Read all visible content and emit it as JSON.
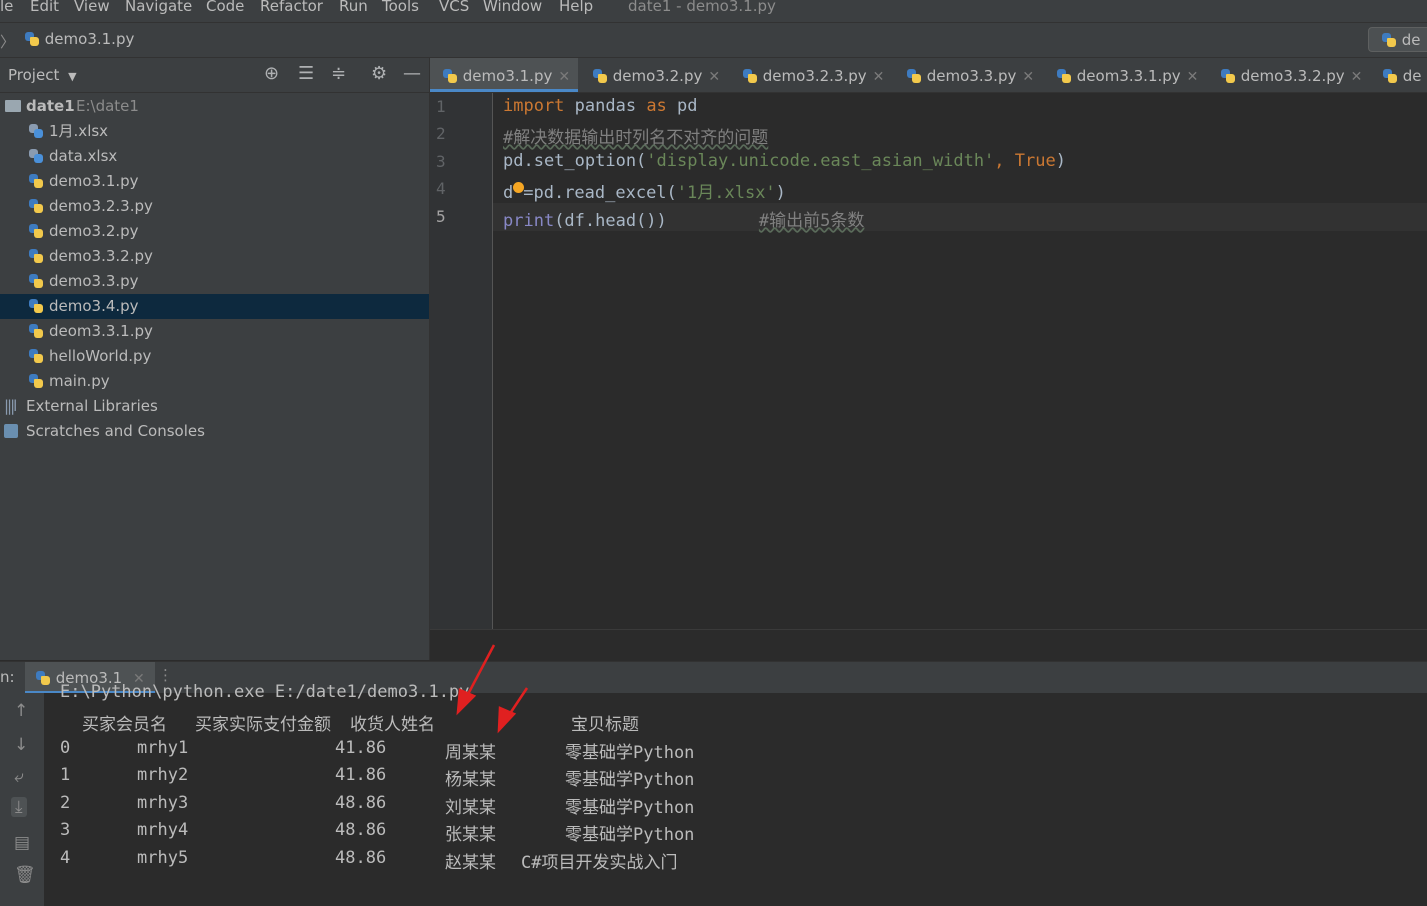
{
  "menu": {
    "items": [
      "le",
      "Edit",
      "View",
      "Navigate",
      "Code",
      "Refactor",
      "Run",
      "Tools",
      "VCS",
      "Window",
      "Help"
    ],
    "window_title": "date1 - demo3.1.py"
  },
  "navbar": {
    "breadcrumb_file": "demo3.1.py",
    "right_button": "de"
  },
  "project": {
    "title": "Project",
    "root_name": "date1",
    "root_path": "E:\\date1",
    "files": [
      "1月.xlsx",
      "data.xlsx",
      "demo3.1.py",
      "demo3.2.3.py",
      "demo3.2.py",
      "demo3.3.2.py",
      "demo3.3.py",
      "demo3.4.py",
      "deom3.3.1.py",
      "helloWorld.py",
      "main.py"
    ],
    "selected_file": "demo3.4.py",
    "external_libraries": "External Libraries",
    "scratches": "Scratches and Consoles"
  },
  "tabs": [
    "demo3.1.py",
    "demo3.2.py",
    "demo3.2.3.py",
    "demo3.3.py",
    "deom3.3.1.py",
    "demo3.3.2.py",
    "de"
  ],
  "active_tab": "demo3.1.py",
  "editor": {
    "line_numbers": [
      "1",
      "2",
      "3",
      "4",
      "5"
    ],
    "line1": {
      "kw1": "import",
      "mod": " pandas ",
      "kw2": "as",
      "alias": " pd"
    },
    "line2": {
      "comment": "#解决数据输出时列名不对齐的问题"
    },
    "line3": {
      "call": "pd.set_option(",
      "str": "'display.unicode.east_asian_width'",
      "comma": ", ",
      "val": "True",
      "close": ")"
    },
    "line4": {
      "pre": "d",
      "mid": "=pd.read_excel(",
      "str": "'1月.xlsx'",
      "close": ")"
    },
    "line5": {
      "fn": "print",
      "args": "(df.head())",
      "comment": "#输出前5条数",
      "spaces": "         "
    }
  },
  "run": {
    "label": "n:",
    "tab": "demo3.1",
    "command": "E:\\Python\\python.exe E:/date1/demo3.1.py",
    "headers": [
      "买家会员名",
      "买家实际支付金额",
      "收货人姓名",
      "宝贝标题"
    ],
    "rows": [
      {
        "idx": "0",
        "member": "mrhy1",
        "amount": "41.86",
        "name": "周某某",
        "title": "零基础学Python"
      },
      {
        "idx": "1",
        "member": "mrhy2",
        "amount": "41.86",
        "name": "杨某某",
        "title": "零基础学Python"
      },
      {
        "idx": "2",
        "member": "mrhy3",
        "amount": "48.86",
        "name": "刘某某",
        "title": "零基础学Python"
      },
      {
        "idx": "3",
        "member": "mrhy4",
        "amount": "48.86",
        "name": "张某某",
        "title": "零基础学Python"
      },
      {
        "idx": "4",
        "member": "mrhy5",
        "amount": "48.86",
        "name": "赵某某",
        "title": "C#项目开发实战入门"
      }
    ]
  },
  "colors": {
    "keyword": "#cc7832",
    "string": "#6a8759",
    "comment": "#808080",
    "selection": "#0d293e",
    "arrow": "#e02020"
  }
}
